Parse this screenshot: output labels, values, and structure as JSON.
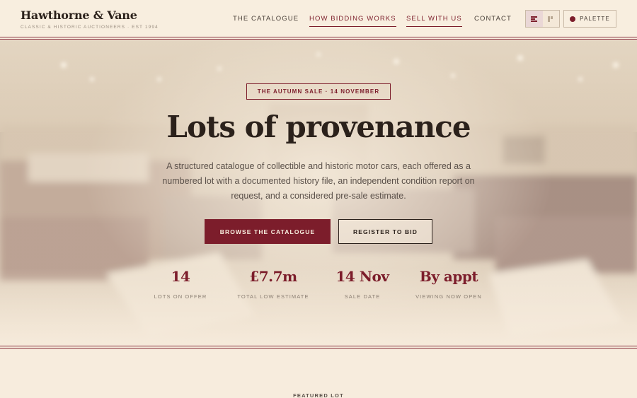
{
  "header": {
    "brand_name": "Hawthorne & Vane",
    "brand_tagline": "CLASSIC & HISTORIC AUCTIONEERS · EST 1994",
    "nav": [
      {
        "label": "THE CATALOGUE",
        "active": false
      },
      {
        "label": "HOW BIDDING WORKS",
        "active": true
      },
      {
        "label": "SELL WITH US",
        "active": true
      },
      {
        "label": "CONTACT",
        "active": false
      }
    ],
    "palette_label": "PALETTE",
    "theme_toggle_icon": "layout-toggle-icon",
    "palette_icon": "color-dot-icon"
  },
  "hero": {
    "eyebrow": "THE AUTUMN SALE · 14 NOVEMBER",
    "title": "Lots of provenance",
    "description": "A structured catalogue of collectible and historic motor cars, each offered as a numbered lot with a documented history file, an independent condition report on request, and a considered pre-sale estimate.",
    "primary_cta": "BROWSE THE CATALOGUE",
    "secondary_cta": "REGISTER TO BID",
    "stats": [
      {
        "value": "14",
        "label": "LOTS ON OFFER"
      },
      {
        "value": "£7.7m",
        "label": "TOTAL LOW ESTIMATE"
      },
      {
        "value": "14 Nov",
        "label": "SALE DATE"
      },
      {
        "value": "By appt",
        "label": "VIEWING NOW OPEN"
      }
    ],
    "background": "showroom-photo"
  },
  "featured": {
    "label": "FEATURED LOT"
  },
  "colors": {
    "accent": "#7c1d2b",
    "background": "#f7ecdd",
    "text": "#2b211b"
  }
}
